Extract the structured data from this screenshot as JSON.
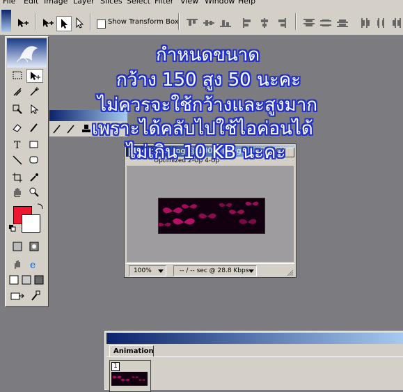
{
  "menu": [
    "File",
    "Edit",
    "Image",
    "Layer",
    "Slices",
    "Select",
    "Filter",
    "View",
    "Window",
    "Help"
  ],
  "options_bar": {
    "show_transform_box_label": "Show Transform Box",
    "show_transform_box_checked": false
  },
  "document": {
    "title": "x7zJwJ1j.jpg @ 100% (Orig...",
    "tab_partial": "Optimized  2-Up  4-Up",
    "zoom": "100%",
    "download_time": "-- / -- sec @ 28.8 Kbps",
    "image_colors": {
      "bg": "#120010",
      "accent": "#c0106a"
    }
  },
  "animation_palette": {
    "tab_label": "Animation",
    "frame_number": "1"
  },
  "overlay_text": [
    "กำหนดขนาด",
    "กว้าง 150 สูง 50 นะคะ",
    "ไม่ควรจะใช้กว้างและสูงมาก",
    "เพราะได้คลับไปใช้ไอค่อนได้",
    "ไม่เกิน 10 KB นะคะ"
  ],
  "colors": {
    "foreground": "#f01830",
    "background": "#ffffff",
    "workspace": "#7b7b80",
    "overlay_outline": "#2030c8"
  }
}
